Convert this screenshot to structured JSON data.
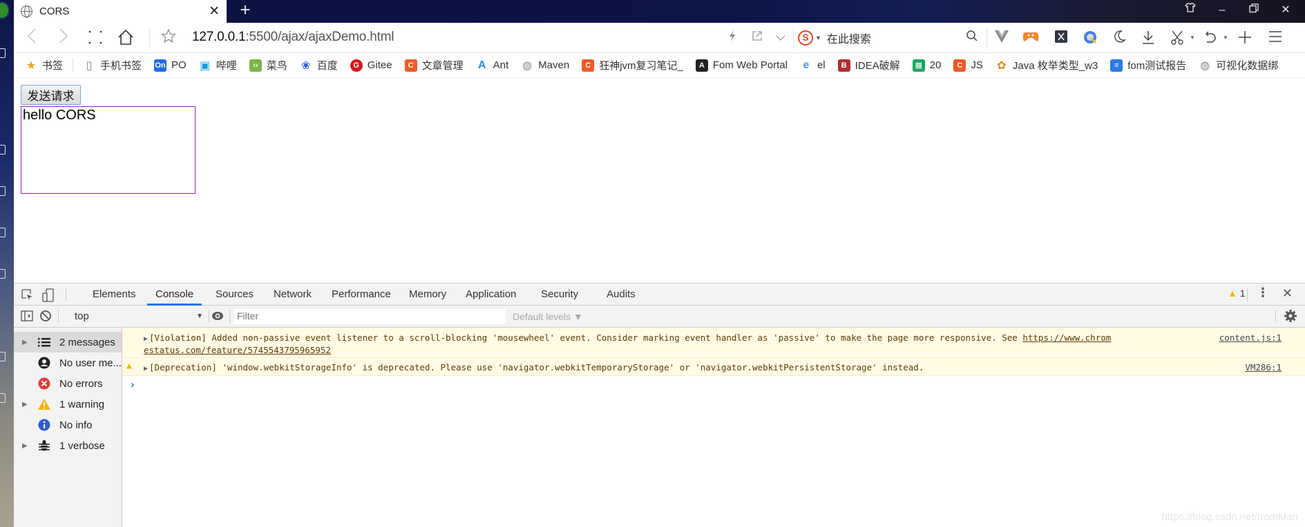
{
  "browser": {
    "tab": {
      "title": "CORS",
      "icon": "globe-icon"
    },
    "address": {
      "host": "127.0.0.1",
      "rest": ":5500/ajax/ajaxDemo.html"
    },
    "search": {
      "engine_icon": "sogou-icon",
      "placeholder": "在此搜索"
    },
    "window_controls": [
      "skin-icon",
      "minimize-icon",
      "restore-icon",
      "close-icon"
    ],
    "toolbar_icons": [
      "vue-devtools-icon",
      "game-icon",
      "x-extension-icon",
      "translate-icon",
      "night-mode-icon",
      "download-icon",
      "screenshot-icon",
      "undo-icon",
      "new-icon",
      "menu-icon"
    ]
  },
  "bookmarks": [
    {
      "label": "书签",
      "icon": "star-icon",
      "color": "#f5a01a"
    },
    {
      "label": "手机书签",
      "icon": "phone-icon",
      "color": "#888888"
    },
    {
      "label": "PO",
      "icon": "on-icon",
      "color": "#1e6fe0"
    },
    {
      "label": "哔哩",
      "icon": "bilibili-icon",
      "color": "#19a0e0"
    },
    {
      "label": "菜鸟",
      "icon": "runoob-icon",
      "color": "#7ab648"
    },
    {
      "label": "百度",
      "icon": "baidu-icon",
      "color": "#2e5bd9"
    },
    {
      "label": "Gitee",
      "icon": "gitee-icon",
      "color": "#d7181c"
    },
    {
      "label": "文章管理",
      "icon": "csdn-icon",
      "color": "#f05a28"
    },
    {
      "label": "Ant",
      "icon": "ant-icon",
      "color": "#2f8cf0"
    },
    {
      "label": "Maven",
      "icon": "globe-icon",
      "color": "#888888"
    },
    {
      "label": "狂神jvm复习笔记_",
      "icon": "csdn-icon",
      "color": "#f05a28"
    },
    {
      "label": "Fom Web Portal",
      "icon": "angular-icon",
      "color": "#222222"
    },
    {
      "label": "el",
      "icon": "element-icon",
      "color": "#409eff"
    },
    {
      "label": "IDEA破解",
      "icon": "jetbrains-icon",
      "color": "#b03030"
    },
    {
      "label": "20",
      "icon": "sheet-icon",
      "color": "#1fa463"
    },
    {
      "label": "JS",
      "icon": "csdn-icon",
      "color": "#f05a28"
    },
    {
      "label": "Java 枚举类型_w3",
      "icon": "w3-icon",
      "color": "#e08a1a"
    },
    {
      "label": "fom测试报告",
      "icon": "doc-icon",
      "color": "#2a7ae2"
    },
    {
      "label": "可视化数据绑",
      "icon": "globe-icon",
      "color": "#888888"
    }
  ],
  "page": {
    "send_button": "发送请求",
    "result_text": "hello CORS"
  },
  "devtools": {
    "tabs": [
      "Elements",
      "Console",
      "Sources",
      "Network",
      "Performance",
      "Memory",
      "Application",
      "Security",
      "Audits"
    ],
    "active_tab": "Console",
    "warning_count": "1",
    "context": "top",
    "filter_placeholder": "Filter",
    "levels": "Default levels ▼",
    "sidebar": [
      {
        "label": "2 messages",
        "icon": "list-icon",
        "expandable": true,
        "selected": true
      },
      {
        "label": "No user me...",
        "icon": "user-icon",
        "expandable": false
      },
      {
        "label": "No errors",
        "icon": "error-icon",
        "expandable": false
      },
      {
        "label": "1 warning",
        "icon": "warning-icon",
        "expandable": true
      },
      {
        "label": "No info",
        "icon": "info-icon",
        "expandable": false
      },
      {
        "label": "1 verbose",
        "icon": "bug-icon",
        "expandable": true
      }
    ],
    "messages": [
      {
        "type": "violation",
        "text": "[Violation] Added non-passive event listener to a scroll-blocking 'mousewheel' event. Consider marking event handler as 'passive' to make the page more responsive. See ",
        "link": "https://www.chromestatus.com/feature/5745543795965952",
        "link_line1": "https://www.chrom",
        "link_line2": "estatus.com/feature/5745543795965952",
        "source": "content.js:1"
      },
      {
        "type": "warning",
        "text": "[Deprecation] 'window.webkitStorageInfo' is deprecated. Please use 'navigator.webkitTemporaryStorage' or 'navigator.webkitPersistentStorage' instead.",
        "source": "VM286:1"
      }
    ]
  },
  "watermark": "https://blog.csdn.net/IromMan"
}
